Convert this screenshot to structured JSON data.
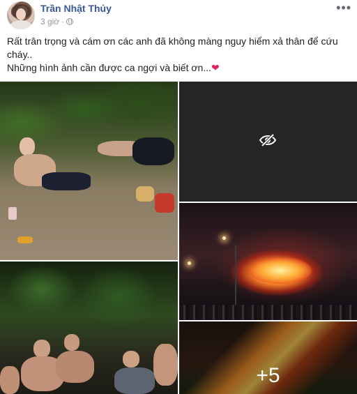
{
  "post": {
    "author": "Trần Nhật Thủy",
    "time": "3 giờ",
    "separator": "·",
    "more_label": "•••",
    "text_lines": [
      "Rất trân trọng và cám ơn các anh đã không màng nguy hiểm xả thân để cứu cháy..",
      "Những hình ảnh cần được ca ngợi và biết ơn..."
    ],
    "heart_emoji": "❤",
    "extra_photos_label": "+5"
  },
  "icons": {
    "privacy": "globe-icon",
    "more": "more-options-icon",
    "hidden_media": "eye-slash-icon",
    "reaction": "red-heart-icon"
  },
  "colors": {
    "author": "#385898",
    "meta": "#90949c",
    "heart": "#e0245e"
  }
}
